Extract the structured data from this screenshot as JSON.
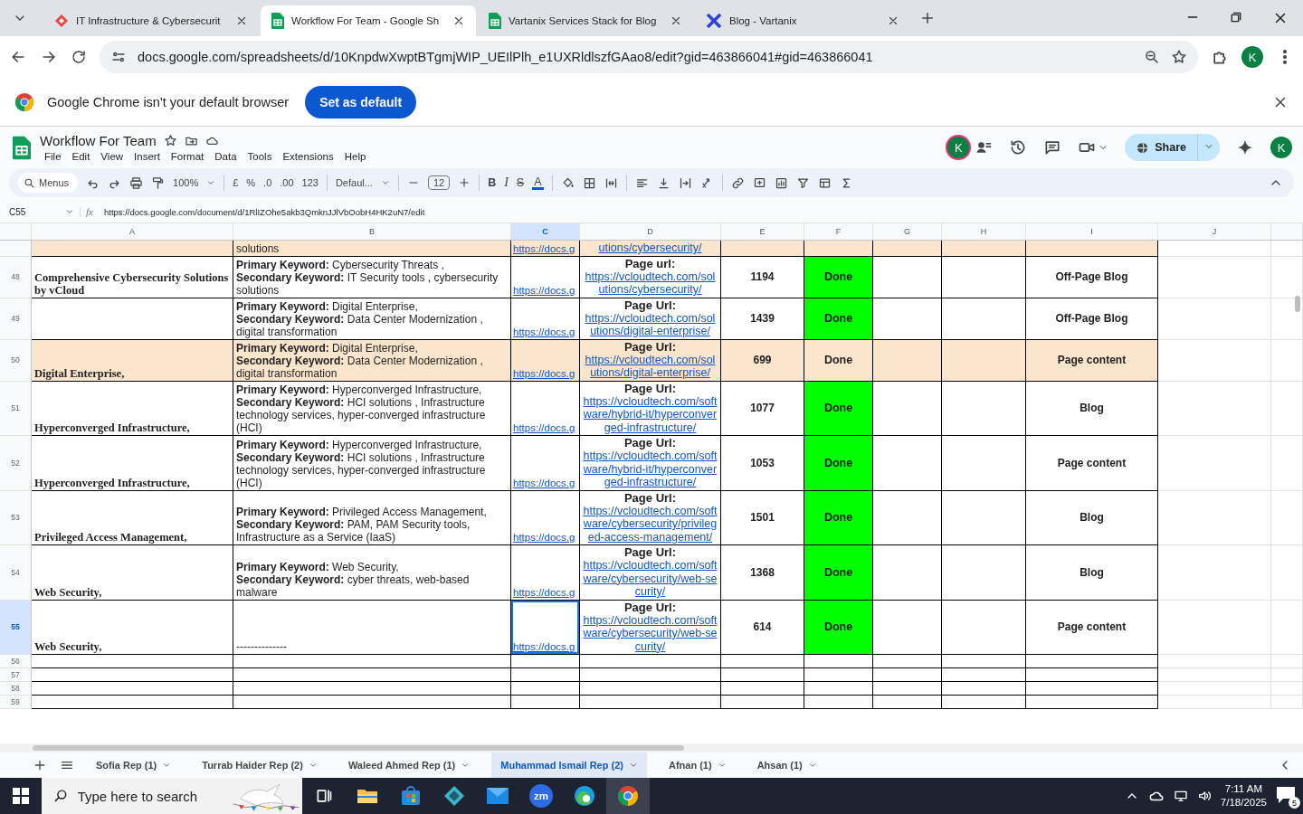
{
  "browser": {
    "tabs": [
      {
        "title": "IT Infrastructure & Cybersecurit",
        "selected": false
      },
      {
        "title": "Workflow For Team - Google Sh",
        "selected": true
      },
      {
        "title": "Vartanix Services Stack for Blog",
        "selected": false
      },
      {
        "title": "Blog - Vartanix",
        "selected": false
      }
    ],
    "url": "docs.google.com/spreadsheets/d/10KnpdwXwptBTgmjWIP_UEIlPlh_e1UXRldlszfGAao8/edit?gid=463866041#gid=463866041",
    "profile": "K"
  },
  "infobar": {
    "message": "Google Chrome isn't your default browser",
    "button": "Set as default"
  },
  "doc": {
    "title": "Workflow For Team",
    "menus": [
      "File",
      "Edit",
      "View",
      "Insert",
      "Format",
      "Data",
      "Tools",
      "Extensions",
      "Help"
    ],
    "collaborator": "K",
    "share": "Share",
    "account": "K"
  },
  "toolbar": {
    "search": "Menus",
    "zoom": "100%",
    "currency": "£",
    "percent": "%",
    "decrease_decimals": ".0",
    "increase_decimals": ".00",
    "number_format": "123",
    "font": "Defaul...",
    "font_size": "12",
    "bold": "B",
    "italic": "I",
    "strikethrough": "S",
    "text_color": "A"
  },
  "formula_bar": {
    "cell": "C55",
    "function_symbol": "fx",
    "formula": "https://docs.google.com/document/d/1RlIZOhe5akb3QmknJJlVbOobH4HK2uN7/edit"
  },
  "columns": [
    {
      "label": "A",
      "selected": false
    },
    {
      "label": "B",
      "selected": false
    },
    {
      "label": "C",
      "selected": true
    },
    {
      "label": "D",
      "selected": false
    },
    {
      "label": "E",
      "selected": false
    },
    {
      "label": "F",
      "selected": false
    },
    {
      "label": "G",
      "selected": false
    },
    {
      "label": "H",
      "selected": false
    },
    {
      "label": "I",
      "selected": false
    },
    {
      "label": "J",
      "selected": false
    }
  ],
  "rows": [
    {
      "highlighted": true,
      "selected": false,
      "b": "solutions",
      "c": "https://docs.g",
      "d": {
        "link": "utions/cybersecurity/"
      }
    },
    {
      "number": "48",
      "highlighted": false,
      "selected": false,
      "a": "Comprehensive Cybersecurity Solutions by vCloud",
      "b": "**Primary Keyword:** Cybersecurity Threats ,\n**Secondary Keyword:**  IT Security tools , cybersecurity solutions",
      "c": "https://docs.g",
      "d": {
        "label": "Page url:",
        "link": "https://vcloudtech.com/solutions/cybersecurity/"
      },
      "e": "1194",
      "f": {
        "text": "Done",
        "color": "#00ff00"
      },
      "i": "Off-Page Blog"
    },
    {
      "number": "49",
      "highlighted": false,
      "selected": false,
      "b": "**Primary Keyword:** Digital Enterprise,\n**Secondary Keyword:** Data Center Modernization , digital transformation",
      "c": "https://docs.g",
      "d": {
        "label": "Page Url:",
        "link": "https://vcloudtech.com/solutions/digital-enterprise/"
      },
      "e": "1439",
      "f": {
        "text": "Done",
        "color": "#00ff00"
      },
      "i": "Off-Page Blog"
    },
    {
      "number": "50",
      "highlighted": true,
      "selected": false,
      "a": "Digital Enterprise,",
      "b": "**Primary Keyword:** Digital Enterprise,\n**Secondary Keyword:** Data Center Modernization , digital transformation",
      "c": "https://docs.g",
      "d": {
        "label": "Page Url:",
        "link": "https://vcloudtech.com/solutions/digital-enterprise/"
      },
      "e": "699",
      "f": {
        "text": "Done"
      },
      "i": "Page content"
    },
    {
      "number": "51",
      "highlighted": false,
      "selected": false,
      "a": "Hyperconverged Infrastructure,",
      "b": "**Primary Keyword:** Hyperconverged Infrastructure,\n**Secondary Keyword:** HCI solutions , Infrastructure technology services, hyper-converged infrastructure (HCI)",
      "c": "https://docs.g",
      "d": {
        "label": "Page Url:",
        "link": "https://vcloudtech.com/software/hybrid-it/hyperconverged-infrastructure/"
      },
      "e": "1077",
      "f": {
        "text": "Done",
        "color": "#00ff00"
      },
      "i": "Blog"
    },
    {
      "number": "52",
      "highlighted": false,
      "selected": false,
      "a": "Hyperconverged Infrastructure,",
      "b": "**Primary Keyword:** Hyperconverged Infrastructure,\n**Secondary Keyword:** HCI solutions , Infrastructure technology services, hyper-converged infrastructure (HCI)",
      "c": "https://docs.g",
      "d": {
        "label": "Page Url:",
        "link": "https://vcloudtech.com/software/hybrid-it/hyperconverged-infrastructure/"
      },
      "e": "1053",
      "f": {
        "text": "Done",
        "color": "#00ff00"
      },
      "i": "Page content"
    },
    {
      "number": "53",
      "highlighted": false,
      "selected": false,
      "a": "Privileged Access Management,",
      "b": "**Primary Keyword:** Privileged Access Management,\n**Secondary Keyword:** PAM, PAM Security tools, Infrastructure as a Service (IaaS)",
      "c": "https://docs.g",
      "d": {
        "label": "Page Url:",
        "link": "https://vcloudtech.com/software/cybersecurity/privileged-access-management/"
      },
      "e": "1501",
      "f": {
        "text": "Done",
        "color": "#00ff00"
      },
      "i": "Blog"
    },
    {
      "number": "54",
      "highlighted": false,
      "selected": false,
      "a": "Web Security,",
      "b": "**Primary Keyword:** Web Security,\n**Secondary Keyword:** cyber threats, web-based malware",
      "c": "https://docs.g",
      "d": {
        "label": "Page Url:",
        "link": "https://vcloudtech.com/software/cybersecurity/web-security/"
      },
      "e": "1368",
      "f": {
        "text": "Done",
        "color": "#00ff00"
      },
      "i": "Blog"
    },
    {
      "number": "55",
      "highlighted": false,
      "selected": true,
      "a": "Web Security,",
      "b": "--------------",
      "c": "https://docs.g",
      "d": {
        "label": "Page Url:",
        "link": "https://vcloudtech.com/software/cybersecurity/web-security/"
      },
      "e": "614",
      "f": {
        "text": "Done",
        "color": "#00ff00"
      },
      "i": "Page content"
    },
    {
      "number": "56",
      "highlighted": false,
      "selected": false
    },
    {
      "number": "57",
      "highlighted": false,
      "selected": false
    },
    {
      "number": "58",
      "highlighted": false,
      "selected": false
    },
    {
      "number": "59",
      "highlighted": false,
      "selected": false
    }
  ],
  "sheet_tabs": [
    {
      "label": "Sofia Rep (1)",
      "selected": false
    },
    {
      "label": "Turrab Haider Rep (2)",
      "selected": false
    },
    {
      "label": "Waleed Ahmed Rep (1)",
      "selected": false
    },
    {
      "label": "Muhammad Ismail Rep (2)",
      "selected": true
    },
    {
      "label": "Afnan (1)",
      "selected": false
    },
    {
      "label": "Ahsan (1)",
      "selected": false
    }
  ],
  "taskbar": {
    "search_placeholder": "Type here to search",
    "zoom_label": "zm",
    "time": "7:11 AM",
    "date": "7/18/2025",
    "notifications": "5"
  }
}
